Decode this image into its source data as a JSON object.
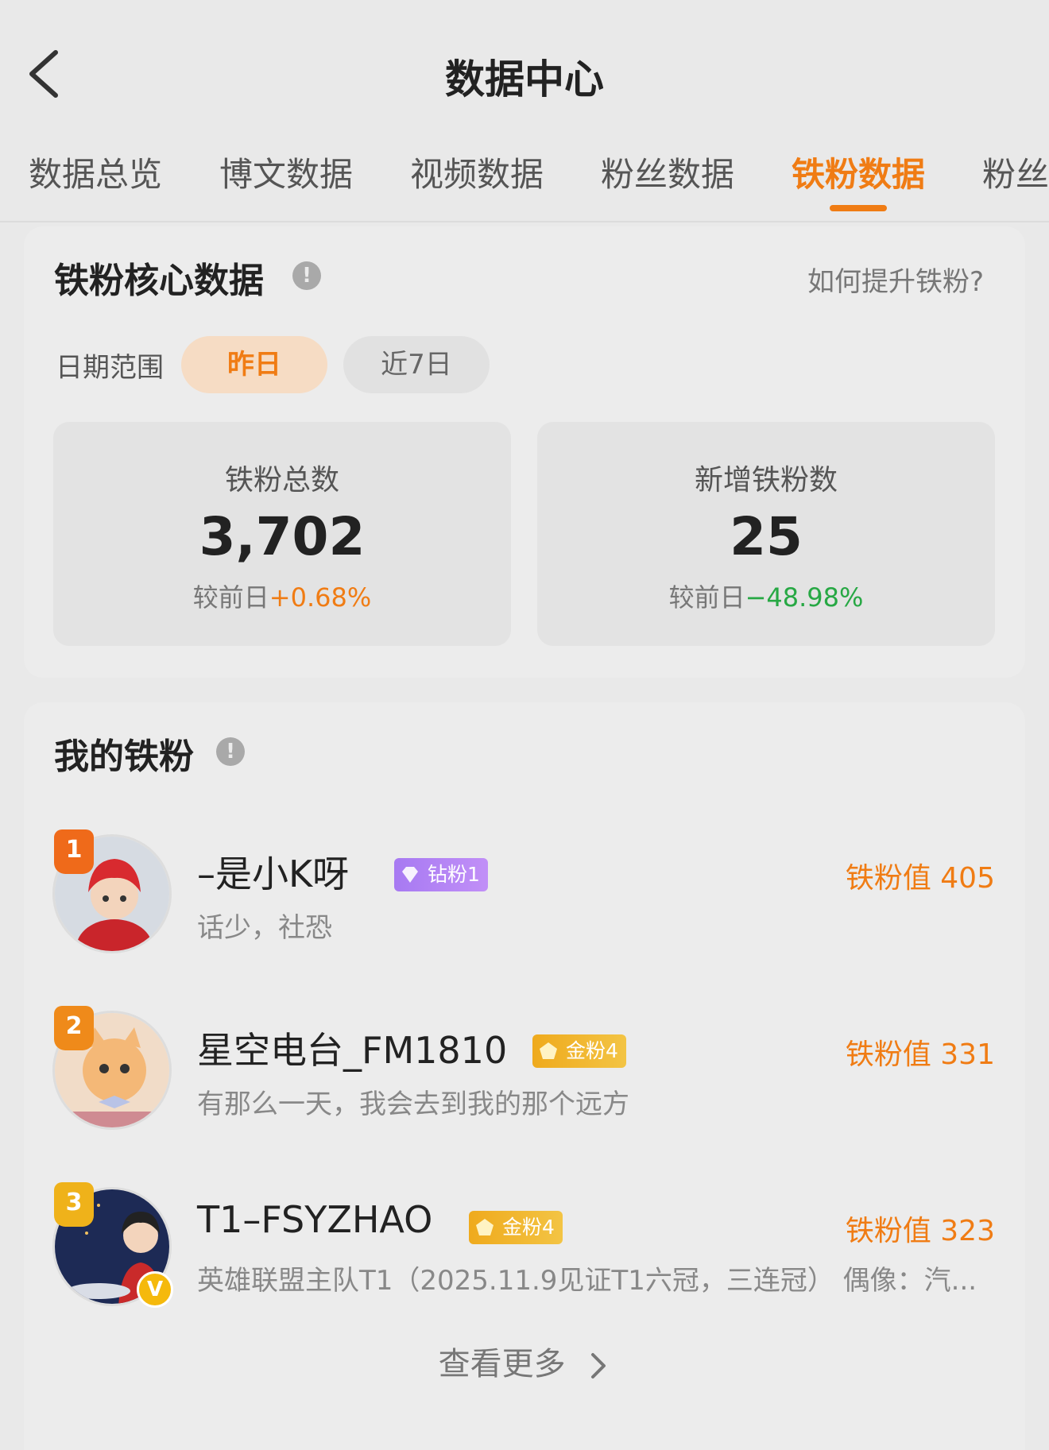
{
  "header": {
    "title": "数据中心"
  },
  "tabs": [
    {
      "label": "数据总览",
      "active": false
    },
    {
      "label": "博文数据",
      "active": false
    },
    {
      "label": "视频数据",
      "active": false
    },
    {
      "label": "粉丝数据",
      "active": false
    },
    {
      "label": "铁粉数据",
      "active": true
    },
    {
      "label": "粉丝",
      "active": false
    }
  ],
  "core": {
    "title": "铁粉核心数据",
    "help_link": "如何提升铁粉?",
    "date_range_label": "日期范围",
    "date_options": [
      "昨日",
      "近7日"
    ],
    "selected_option": "昨日",
    "stats": [
      {
        "label": "铁粉总数",
        "value": "3,702",
        "compare_prefix": "较前日",
        "change": "+0.68%"
      },
      {
        "label": "新增铁粉数",
        "value": "25",
        "compare_prefix": "较前日",
        "change": "−48.98%"
      }
    ]
  },
  "fans": {
    "title": "我的铁粉",
    "items": [
      {
        "rank": "1",
        "name": "–是小K呀",
        "badge": "钻粉1",
        "badge_type": "diamond",
        "desc": "话少，社恐",
        "score": "铁粉值 405"
      },
      {
        "rank": "2",
        "name": "星空电台_FM1810",
        "badge": "金粉4",
        "badge_type": "gold",
        "desc": "有那么一天，我会去到我的那个远方",
        "score": "铁粉值 331"
      },
      {
        "rank": "3",
        "name": "T1–FSYZHAO",
        "badge": "金粉4",
        "badge_type": "gold",
        "desc": "英雄联盟主队T1（2025.11.9见证T1六冠，三连冠） 偶像：汽...",
        "score": "铁粉值 323",
        "verified": "V"
      }
    ],
    "more_label": "查看更多"
  },
  "colors": {
    "accent": "#f07c14",
    "positive": "#f07c14",
    "negative": "#27a844"
  }
}
